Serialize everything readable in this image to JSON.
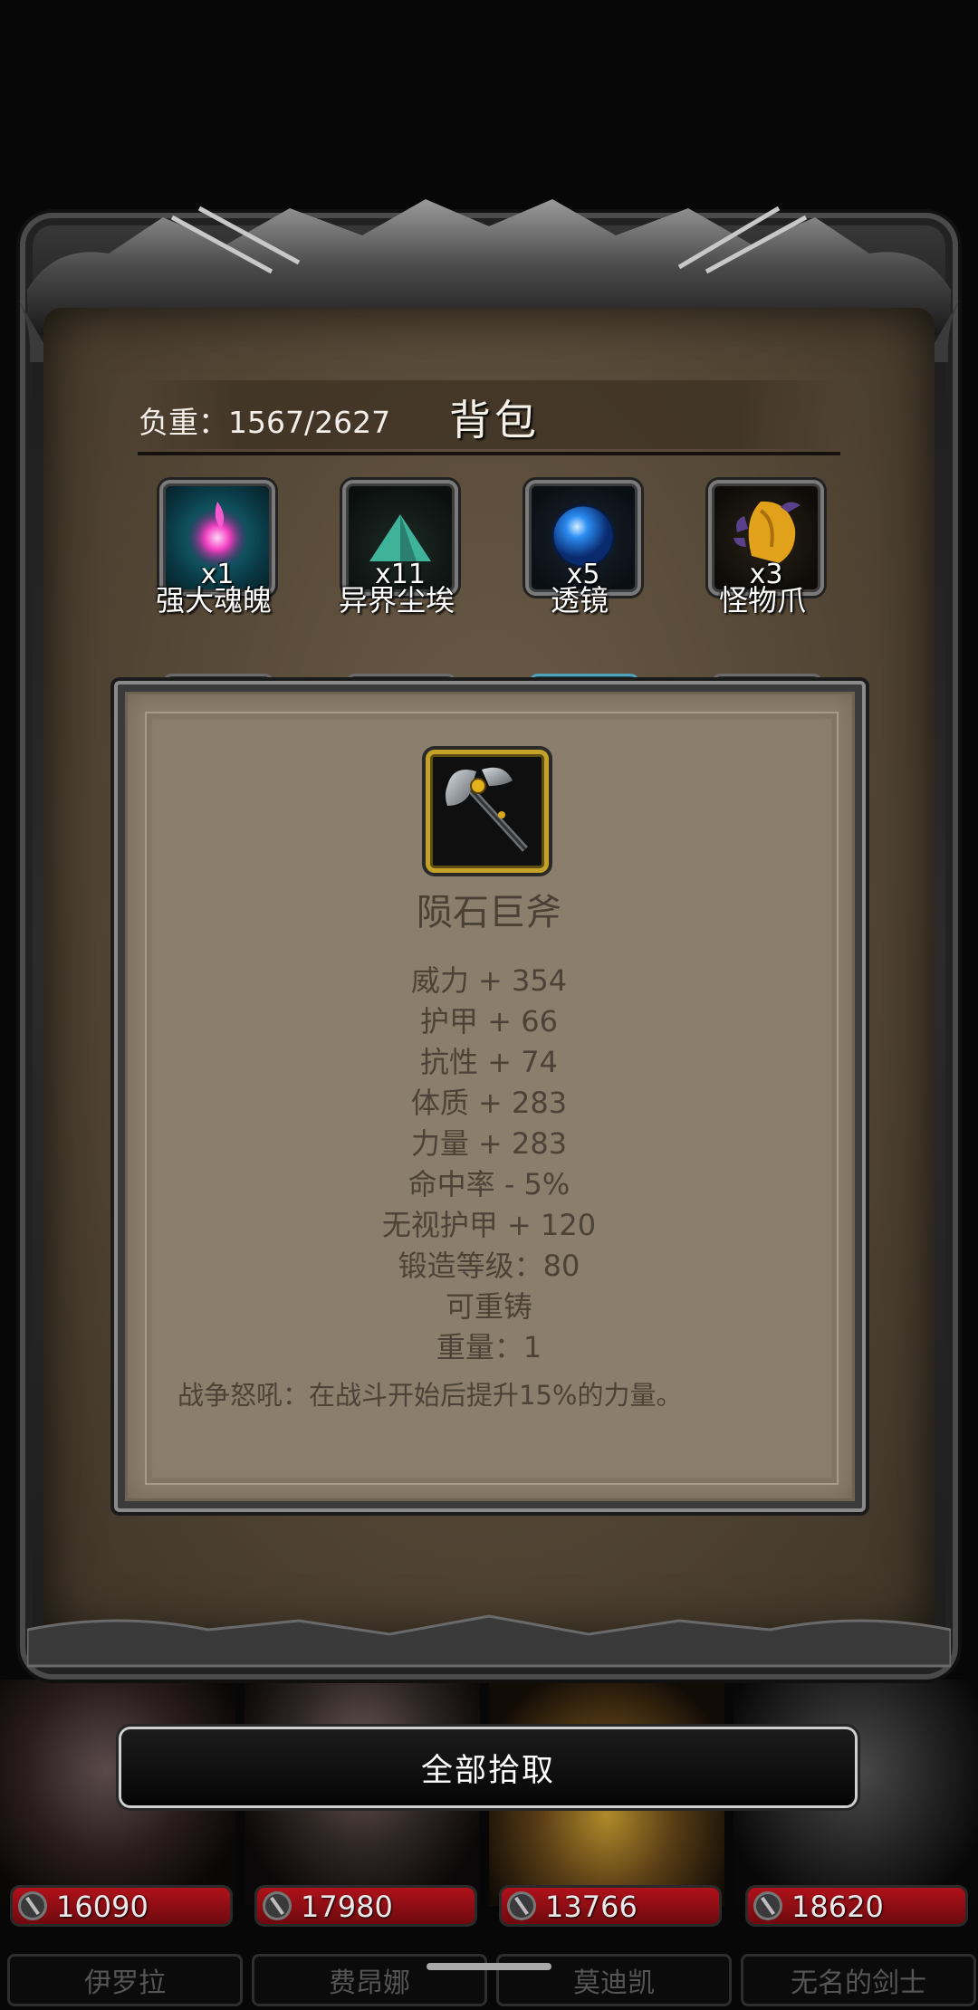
{
  "bag": {
    "title": "背包",
    "weight_label": "负重：1567/2627"
  },
  "items": [
    {
      "name": "强大魂魄",
      "count": "x1",
      "icon": "pink-soul-orb-icon"
    },
    {
      "name": "异界尘埃",
      "count": "x11",
      "icon": "teal-dust-pile-icon"
    },
    {
      "name": "透镜",
      "count": "x5",
      "icon": "blue-lens-orb-icon"
    },
    {
      "name": "怪物爪",
      "count": "x3",
      "icon": "monster-claw-icon"
    }
  ],
  "tooltip": {
    "title": "陨石巨斧",
    "icon": "meteor-greataxe-icon",
    "stats": [
      "威力 + 354",
      "护甲 + 66",
      "抗性 + 74",
      "体质 + 283",
      "力量 + 283",
      "命中率 - 5%",
      "无视护甲 + 120",
      "锻造等级：80",
      "可重铸",
      "重量：1"
    ],
    "description": "战争怒吼：在战斗开始后提升15%的力量。"
  },
  "pickup_button": {
    "label": "全部拾取"
  },
  "heroes": [
    {
      "hp": "16090",
      "name": "伊罗拉"
    },
    {
      "hp": "17980",
      "name": "费昂娜"
    },
    {
      "hp": "13766",
      "name": "莫迪凯"
    },
    {
      "hp": "18620",
      "name": "无名的剑士"
    }
  ],
  "colors": {
    "parchment": "#584a38",
    "tooltip_bg": "#8c7e6c",
    "hp_bar": "#b0111a",
    "legendary_border": "#c4a227"
  }
}
